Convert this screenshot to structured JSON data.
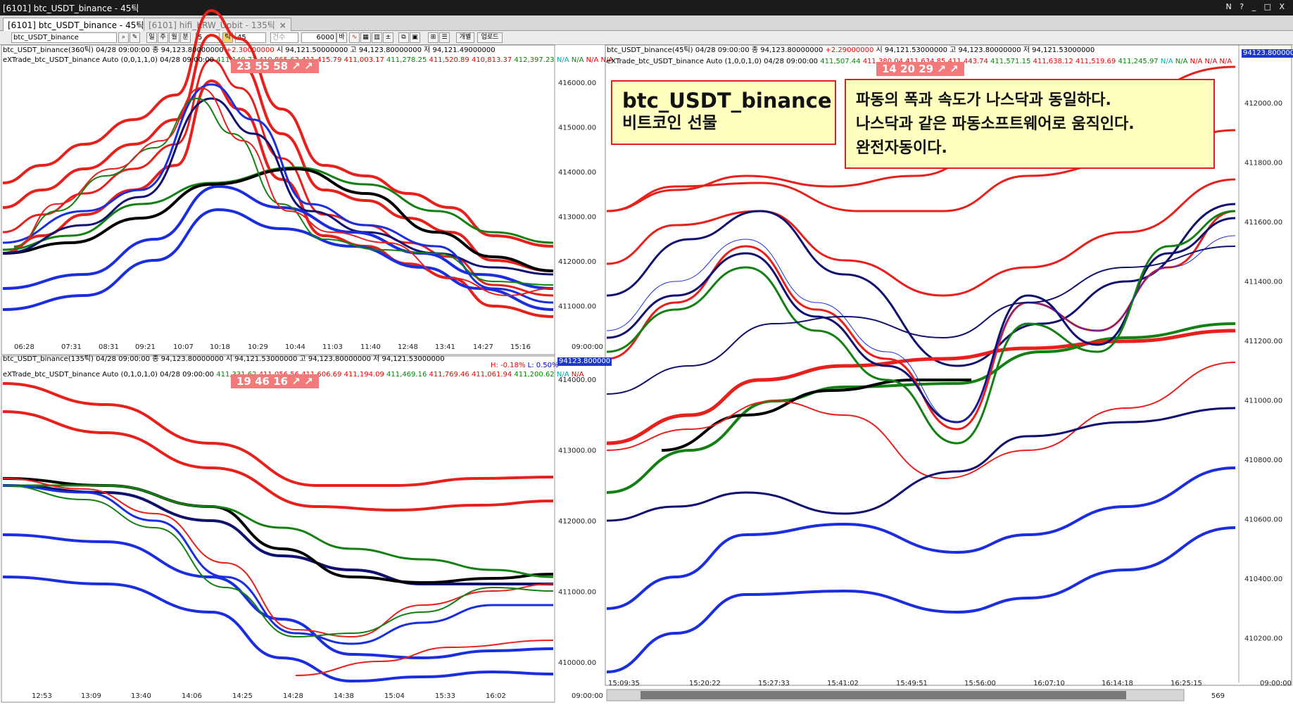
{
  "window": {
    "title": "[6101] btc_USDT_binance - 45틱",
    "controls": "N ? _ □ X"
  },
  "tabs": [
    {
      "label": "[6101] btc_USDT_binance - 45틱",
      "close": "×"
    },
    {
      "label": "[6101] hifi_KRW_Upbit - 135틱",
      "close": "×"
    }
  ],
  "toolbar": {
    "symbol": "btc_USDT_binance",
    "buttons": [
      "일",
      "주",
      "월",
      "분"
    ],
    "interval": "5",
    "tick_label": "틱",
    "tick_count": "45",
    "count_label": "건수",
    "bar_count": "6000",
    "bar_unit": "바",
    "separate_label": "개별",
    "upload_label": "업로드"
  },
  "panes": {
    "topleft": {
      "line1": {
        "name": "btc_USDT_binance(360틱)",
        "date": "04/28 09:00:00",
        "close": "종 94,123.80000000",
        "change": "+2.30000000",
        "open": "시 94,121.50000000",
        "high": "고 94,123.80000000",
        "low": "저 94,121.49000000"
      },
      "line2": {
        "name": "eXTrade_btc_USDT_binance Auto",
        "params": "(0,0,1,1,0) 04/28 09:00:00",
        "green": "411,140.71",
        "red1": "410,865.63",
        "red2": "411,415.79",
        "red3": "411,003.17",
        "red4": "411,278.25",
        "red5": "411,520.89",
        "red6": "410,813.37",
        "green2": "412,397.23",
        "na_cyan": "N/A",
        "na_green": "N/A",
        "na_red": "N/A N/A"
      },
      "counter": "23  55  58 ↗ ↗",
      "yticks": [
        "416000.00",
        "415000.00",
        "414000.00",
        "413000.00",
        "412000.00",
        "411000.00"
      ],
      "xticks": [
        "06:28",
        "07:31",
        "08:31",
        "09:21",
        "10:07",
        "10:18",
        "10:29",
        "10:44",
        "11:03",
        "11:40",
        "12:48",
        "13:41",
        "14:27",
        "15:16"
      ],
      "time_end": "09:00:00"
    },
    "bottomleft": {
      "line1": {
        "name": "btc_USDT_binance(135틱)",
        "date": "04/28 09:00:00",
        "close": "종 94,123.80000000",
        "open": "시 94,121.53000000",
        "high": "고 94,123.80000000",
        "low": "저 94,121.53000000"
      },
      "line2": {
        "name": "eXTrade_btc_USDT_binance Auto",
        "params": "(0,1,0,1,0) 04/28 09:00:00",
        "green": "411,331.62",
        "red1": "411,056.56",
        "red2": "411,606.69",
        "red3": "411,194.09",
        "red4": "411,469.16",
        "red5": "411,769.46",
        "red6": "411,061.94",
        "green2": "411,200.62",
        "na_cyan": "N/A",
        "na_red": "N/A"
      },
      "hl": {
        "high": "H: -0.18%",
        "low": "L: 0.50%"
      },
      "price_label": "94123.800000",
      "counter": "19  46  16 ↗ ↗",
      "yticks": [
        "414000.00",
        "413000.00",
        "412000.00",
        "411000.00",
        "410000.00"
      ],
      "xticks": [
        "12:53",
        "13:09",
        "13:40",
        "14:06",
        "14:25",
        "14:28",
        "14:38",
        "15:04",
        "15:33",
        "16:02"
      ],
      "time_end": "09:00:00"
    },
    "right": {
      "line1": {
        "name": "btc_USDT_binance(45틱)",
        "date": "04/28 09:00:00",
        "close": "종 94,123.80000000",
        "change": "+2.29000000",
        "open": "시 94,121.53000000",
        "high": "고 94,123.80000000",
        "low": "저 94,121.53000000"
      },
      "line2": {
        "name": "eXTrade_btc_USDT_binance Auto",
        "params": "(1,0,0,1,0) 04/28 09:00:00",
        "green": "411,507.44",
        "red1": "411,380.04",
        "red2": "411,634.85",
        "red3": "411,443.74",
        "red4": "411,571.15",
        "red5": "411,638.12",
        "red6": "411,519.69",
        "green2": "411,245.97",
        "na_cyan": "N/A",
        "na_green": "N/A",
        "na_red": "N/A N/A N/A"
      },
      "price_label": "94123.800000",
      "counter": "14  20  29 ↗ ↗",
      "yticks": [
        "412000.00",
        "411800.00",
        "411600.00",
        "411400.00",
        "411200.00",
        "411000.00",
        "410800.00",
        "410600.00",
        "410400.00",
        "410200.00"
      ],
      "xticks": [
        "15:09:35",
        "15:20:22",
        "15:27:33",
        "15:41:02",
        "15:49:51",
        "15:56:00",
        "16:07:10",
        "16:14:18",
        "16:25:15"
      ],
      "time_end": "09:00:00",
      "bar_counter": "569"
    }
  },
  "notes": {
    "symbol_title": "btc_USDT_binance",
    "symbol_sub": "비트코인 선물",
    "desc_line1": "파동의 폭과 속도가 나스닥과 동일하다.",
    "desc_line2": "나스닥과 같은 파동소프트웨어로 움직인다.",
    "desc_line3": "완전자동이다."
  },
  "colors": {
    "red": "#e8201c",
    "green": "#128012",
    "blue": "#1a2ee0",
    "navy": "#101070",
    "black": "#000000",
    "counter_bg": "#f27a7a",
    "note_bg": "#ffffc0"
  }
}
